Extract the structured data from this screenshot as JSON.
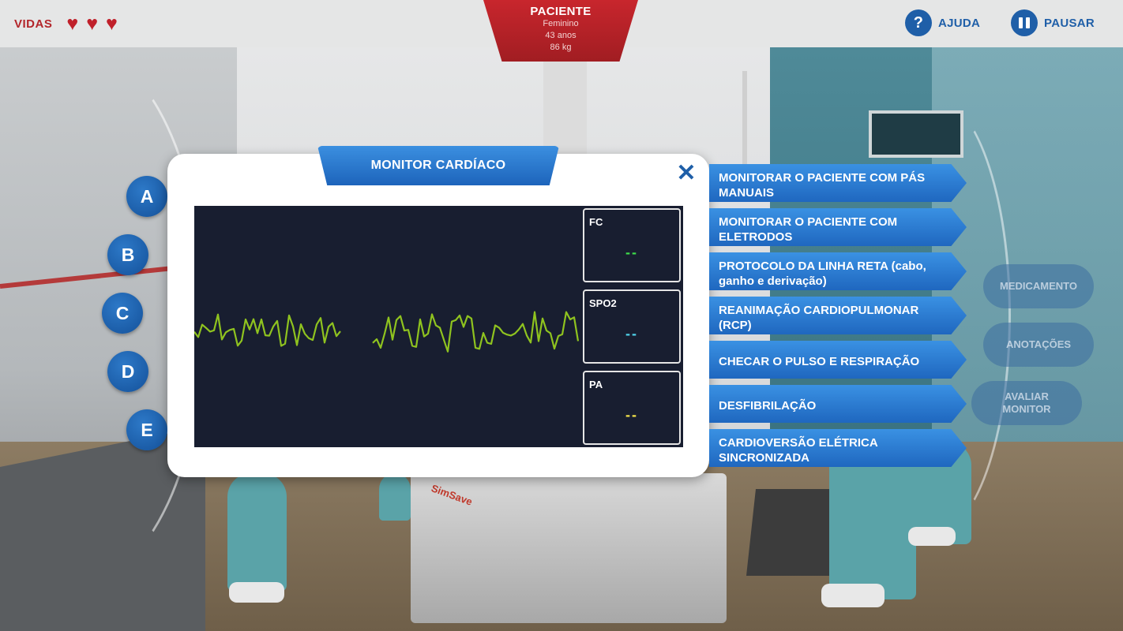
{
  "header": {
    "lives_label": "VIDAS",
    "lives": 3,
    "help_label": "AJUDA",
    "pause_label": "PAUSAR"
  },
  "patient": {
    "title": "PACIENTE",
    "sex": "Feminino",
    "age": "43 anos",
    "weight": "86 kg"
  },
  "options": [
    "A",
    "B",
    "C",
    "D",
    "E"
  ],
  "modal": {
    "title": "MONITOR CARDÍACO",
    "close_symbol": "✕",
    "vitals": [
      {
        "label": "FC",
        "value": "--",
        "color": "#3ddc4a"
      },
      {
        "label": "SPO2",
        "value": "--",
        "color": "#4fd3ea"
      },
      {
        "label": "PA",
        "value": "--",
        "color": "#f2e24a"
      }
    ],
    "ecg_color": "#8fc31f"
  },
  "actions": [
    "MONITORAR O PACIENTE COM PÁS MANUAIS",
    "MONITORAR O PACIENTE COM ELETRODOS",
    "PROTOCOLO DA LINHA RETA (cabo, ganho e derivação)",
    "REANIMAÇÃO CARDIOPULMONAR (RCP)",
    "CHECAR O PULSO E RESPIRAÇÃO",
    "DESFIBRILAÇÃO",
    "CARDIOVERSÃO ELÉTRICA SINCRONIZADA"
  ],
  "side_buttons": {
    "medication": "MEDICAMENTO",
    "notes": "ANOTAÇÕES",
    "evaluate_monitor": "AVALIAR MONITOR"
  },
  "scene": {
    "bed_brand": "SimSave"
  }
}
